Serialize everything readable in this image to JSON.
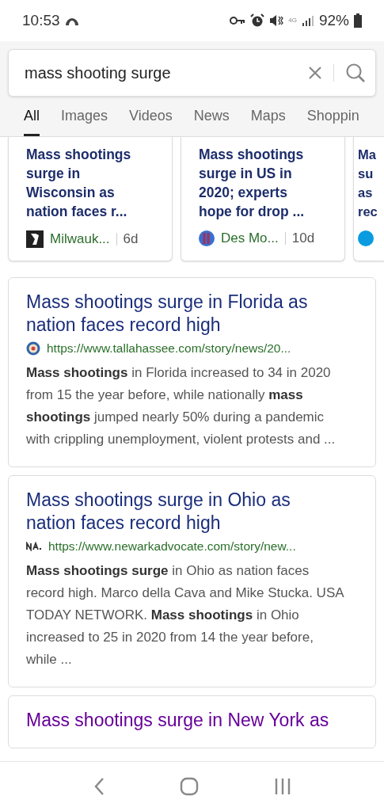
{
  "status_bar": {
    "time": "10:53",
    "battery": "92%",
    "network": "4G"
  },
  "search": {
    "value": "mass shooting surge"
  },
  "tabs": [
    {
      "label": "All",
      "selected": true
    },
    {
      "label": "Images",
      "selected": false
    },
    {
      "label": "Videos",
      "selected": false
    },
    {
      "label": "News",
      "selected": false
    },
    {
      "label": "Maps",
      "selected": false
    },
    {
      "label": "Shoppin",
      "selected": false
    }
  ],
  "news_cards": [
    {
      "title": "Mass shootings surge in Wisconsin as nation faces r...",
      "source": "Milwauk...",
      "age": "6d",
      "kind": "square"
    },
    {
      "title": "Mass shootings surge in US in 2020; experts hope for drop ...",
      "source": "Des Mo...",
      "age": "10d",
      "kind": "round"
    },
    {
      "title": "Ma su as rec",
      "kind": "usa"
    }
  ],
  "results": [
    {
      "title": "Mass shootings surge in Florida as nation faces record high",
      "url": "https://www.tallahassee.com/story/news/20...",
      "kind": "seal",
      "visited": false,
      "snippet": "**Mass shootings** in Florida increased to 34 in 2020 from 15 the year before, while nationally **mass shootings** jumped nearly 50% during a pandemic with crippling unemployment, violent protests and ..."
    },
    {
      "title": "Mass shootings surge in Ohio as nation faces record high",
      "url": "https://www.newarkadvocate.com/story/new...",
      "kind": "na",
      "visited": false,
      "snippet": "**Mass shootings surge** in Ohio as nation faces record high. Marco della Cava and Mike Stucka. USA TODAY NETWORK. **Mass shootings** in Ohio increased to 25 in 2020 from 14 the year before, while ..."
    },
    {
      "title": "Mass shootings surge in New York as",
      "visited": true
    }
  ]
}
